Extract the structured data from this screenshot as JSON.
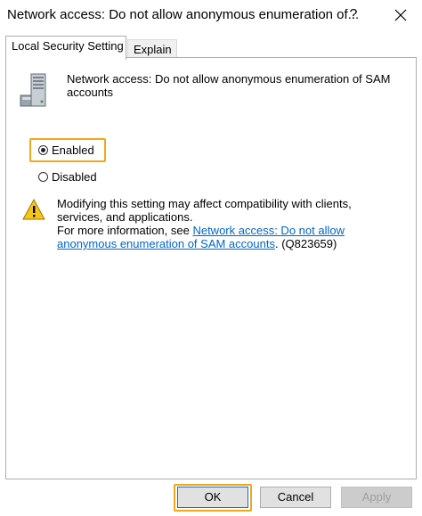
{
  "window": {
    "title": "Network access: Do not allow anonymous enumeration of...",
    "help_label": "?",
    "close_label": "close"
  },
  "tabs": [
    {
      "label": "Local Security Setting",
      "active": true
    },
    {
      "label": "Explain",
      "active": false
    }
  ],
  "policy": {
    "name": "Network access: Do not allow anonymous enumeration of SAM accounts"
  },
  "options": {
    "enabled_label": "Enabled",
    "disabled_label": "Disabled",
    "selected": "Enabled"
  },
  "warning": {
    "line1": "Modifying this setting may affect compatibility with clients, services, and applications.",
    "more_info_prefix": "For more information, see ",
    "link_text": "Network access: Do not allow anonymous enumeration of SAM accounts",
    "suffix": ". (Q823659)"
  },
  "buttons": {
    "ok": "OK",
    "cancel": "Cancel",
    "apply": "Apply"
  },
  "colors": {
    "highlight": "#f2a71b",
    "link": "#0066cc",
    "accent": "#0078d7"
  }
}
